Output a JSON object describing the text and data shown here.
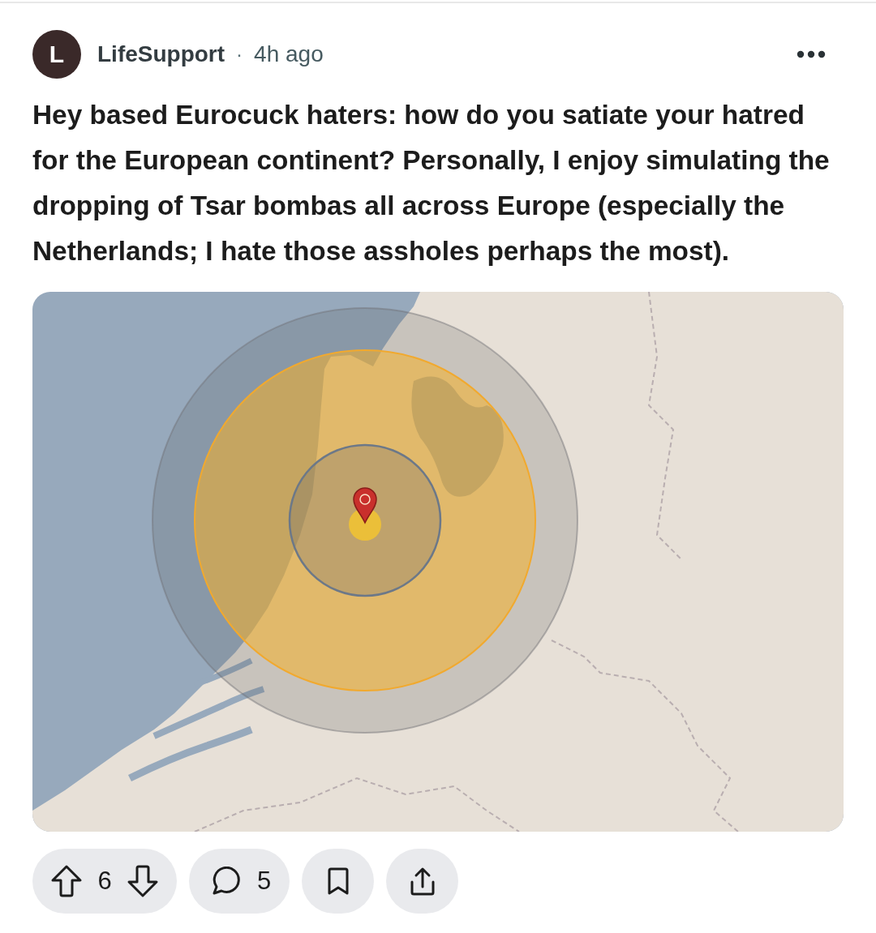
{
  "post": {
    "author": {
      "avatar_letter": "L",
      "name": "LifeSupport"
    },
    "separator": "·",
    "time": "4h ago",
    "title": "Hey based Eurocuck haters: how do you satiate your hatred for the European continent? Personally, I enjoy simulating the dropping of Tsar bombas all across Europe (especially the Netherlands; I hate those assholes perhaps the most).",
    "media": {
      "kind": "map"
    },
    "actions": {
      "score": "6",
      "comments": "5"
    }
  }
}
